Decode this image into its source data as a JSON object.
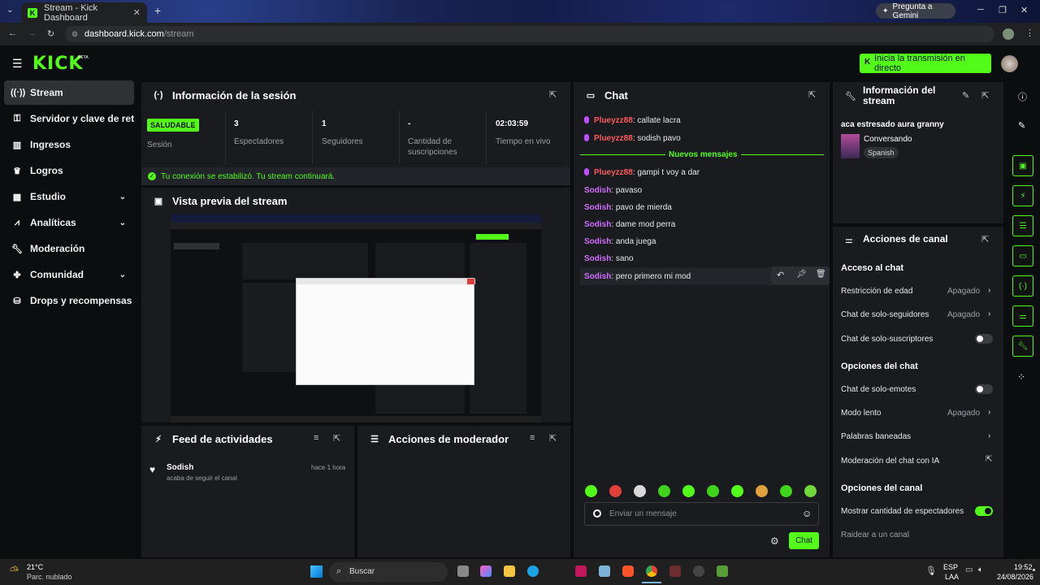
{
  "browser": {
    "tab_title": "Stream - Kick Dashboard",
    "tab_close": "✕",
    "new_tab": "+",
    "gemini_label": "Pregunta a Gemini",
    "url_host": "dashboard.kick.com",
    "url_path": "/stream"
  },
  "kick": {
    "logo": "KICK",
    "beta": "BETA",
    "go_live_label": "Inicia la transmisión en directo"
  },
  "sidebar": {
    "items": [
      {
        "label": "Stream",
        "icon": "broadcast-icon"
      },
      {
        "label": "Servidor y clave de retransmisión",
        "icon": "key-icon"
      },
      {
        "label": "Ingresos",
        "icon": "chart-icon"
      },
      {
        "label": "Logros",
        "icon": "trophy-icon"
      },
      {
        "label": "Estudio",
        "icon": "studio-icon"
      },
      {
        "label": "Analíticas",
        "icon": "analytics-icon"
      },
      {
        "label": "Moderación",
        "icon": "wrench-icon"
      },
      {
        "label": "Comunidad",
        "icon": "community-icon"
      },
      {
        "label": "Drops y recompensas",
        "icon": "drops-icon"
      }
    ]
  },
  "session": {
    "title": "Información de la sesión",
    "health_badge": "SALUDABLE",
    "health_label": "Sesión",
    "stats": [
      {
        "value": "3",
        "label": "Espectadores"
      },
      {
        "value": "1",
        "label": "Seguidores"
      },
      {
        "value": "-",
        "label": "Cantidad de suscripciones"
      },
      {
        "value": "02:03:59",
        "label": "Tiempo en vivo"
      }
    ],
    "status_message": "Tu conexión se estabilizó. Tu stream continuará."
  },
  "preview": {
    "title": "Vista previa del stream"
  },
  "activity": {
    "title": "Feed de actividades",
    "items": [
      {
        "user": "Sodish",
        "action": "acaba de seguir el canal",
        "time": "hace 1 hora"
      }
    ]
  },
  "mod_actions": {
    "title": "Acciones de moderador"
  },
  "chat": {
    "title": "Chat",
    "new_messages_label": "Nuevos mensajes",
    "messages": [
      {
        "user": "Plueyzz88",
        "text": ": callate lacra",
        "color": "#ff5a5a",
        "mic": true
      },
      {
        "user": "Plueyzz88",
        "text": ": sodish pavo",
        "color": "#ff5a5a",
        "mic": true
      },
      {
        "user": "Plueyzz88",
        "text": ": gampi t voy a dar",
        "color": "#ff5a5a",
        "mic": true
      },
      {
        "user": "Sodish",
        "text": ": pavaso",
        "color": "#d36bff",
        "mic": false
      },
      {
        "user": "Sodish",
        "text": ": pavo de mierda",
        "color": "#d36bff",
        "mic": false
      },
      {
        "user": "Sodish",
        "text": ": dame mod perra",
        "color": "#d36bff",
        "mic": false
      },
      {
        "user": "Sodish",
        "text": ": anda juega",
        "color": "#d36bff",
        "mic": false
      },
      {
        "user": "Sodish",
        "text": ": sano",
        "color": "#d36bff",
        "mic": false
      },
      {
        "user": "Sodish",
        "text": ": pero primero mi mod",
        "color": "#d36bff",
        "mic": false
      }
    ],
    "input_placeholder": "Enviar un mensaje",
    "send_label": "Chat"
  },
  "stream_info": {
    "title": "Información del stream",
    "stream_title": "aca estresado aura granny",
    "category": "Conversando",
    "language": "Spanish"
  },
  "channel_actions": {
    "title": "Acciones de canal",
    "sections": {
      "chat_access": "Acceso al chat",
      "chat_options": "Opciones del chat",
      "channel_options": "Opciones del canal"
    },
    "rows": {
      "age_restriction": {
        "label": "Restricción de edad",
        "value": "Apagado"
      },
      "followers_only": {
        "label": "Chat de solo-seguidores",
        "value": "Apagado"
      },
      "subs_only": {
        "label": "Chat de solo-suscriptores"
      },
      "emotes_only": {
        "label": "Chat de solo-emotes"
      },
      "slow_mode": {
        "label": "Modo lento",
        "value": "Apagado"
      },
      "banned_words": {
        "label": "Palabras baneadas"
      },
      "ai_moderation": {
        "label": "Moderación del chat con IA"
      },
      "show_viewers": {
        "label": "Mostrar cantidad de espectadores"
      },
      "raid": {
        "label": "Raidear a un canal"
      }
    }
  },
  "taskbar": {
    "weather_temp": "21°C",
    "weather_desc": "Parc. nublado",
    "search_label": "Buscar",
    "lang_1": "ESP",
    "lang_2": "LAA",
    "time": "19:52",
    "date": "24/08/2026"
  },
  "colors": {
    "accent": "#53fc18",
    "panel": "#191b1f",
    "background": "#0b0e0f"
  }
}
